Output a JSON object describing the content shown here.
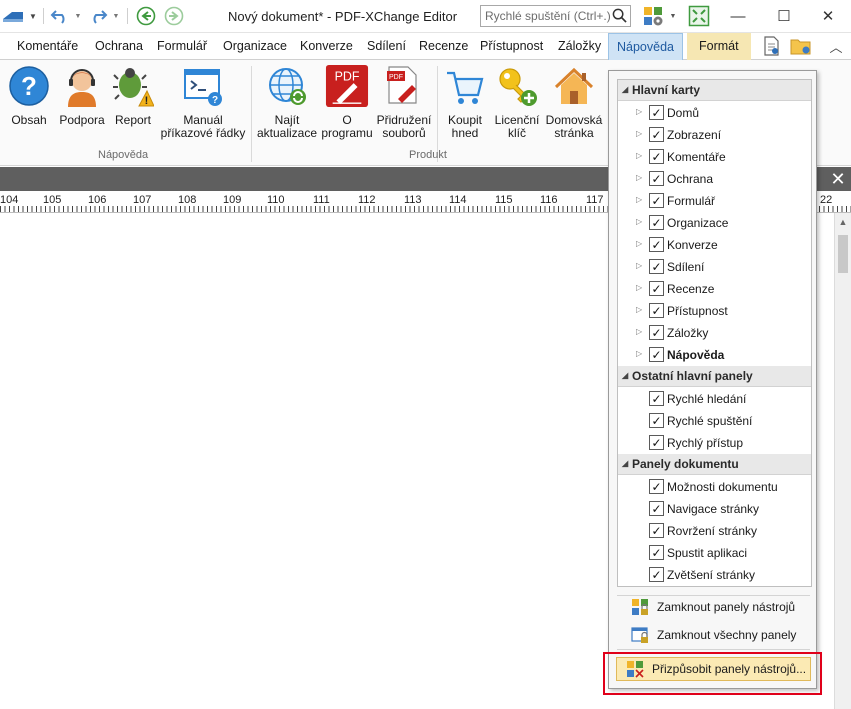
{
  "window": {
    "title": "Nový dokument* - PDF-XChange Editor",
    "quick_launch_placeholder": "Rychlé spuštění (Ctrl+.)",
    "close_glyph": "✕",
    "maximize_glyph": "☐",
    "minimize_glyph": "—",
    "qat_icons": [
      "dropdown-menu-icon",
      "undo-icon",
      "redo-icon",
      "back-icon",
      "forward-icon"
    ]
  },
  "tabs": [
    {
      "label": "Komentáře"
    },
    {
      "label": "Ochrana"
    },
    {
      "label": "Formulář"
    },
    {
      "label": "Organizace"
    },
    {
      "label": "Konverze"
    },
    {
      "label": "Sdílení"
    },
    {
      "label": "Recenze"
    },
    {
      "label": "Přístupnost"
    },
    {
      "label": "Záložky"
    },
    {
      "label": "Nápověda"
    },
    {
      "label": "Formát"
    }
  ],
  "ribbon": {
    "groups": [
      {
        "label": "Nápověda"
      },
      {
        "label": "Produkt"
      }
    ],
    "buttons": [
      {
        "line1": "Obsah",
        "line2": "",
        "icon": "help-icon"
      },
      {
        "line1": "Podpora",
        "line2": "",
        "icon": "support-icon"
      },
      {
        "line1": "Report",
        "line2": "",
        "icon": "bug-report-icon"
      },
      {
        "line1": "Manuál",
        "line2": "příkazové řádky",
        "icon": "command-line-icon"
      },
      {
        "line1": "Najít",
        "line2": "aktualizace",
        "icon": "update-icon"
      },
      {
        "line1": "O",
        "line2": "programu",
        "icon": "pdf-about-icon"
      },
      {
        "line1": "Přidružení",
        "line2": "souborů",
        "icon": "file-association-icon"
      },
      {
        "line1": "Koupit",
        "line2": "hned",
        "icon": "cart-icon"
      },
      {
        "line1": "Licenční",
        "line2": "klíč",
        "icon": "license-key-icon"
      },
      {
        "line1": "Domovská",
        "line2": "stránka",
        "icon": "home-icon"
      }
    ]
  },
  "ruler": {
    "labels": [
      "104",
      "105",
      "106",
      "107",
      "108",
      "109",
      "110",
      "111",
      "112",
      "113",
      "114",
      "115",
      "116",
      "117",
      "22"
    ]
  },
  "doc_tabs_close": "✕",
  "dropdown": {
    "sections": [
      {
        "title": "Hlavní karty",
        "items": [
          {
            "label": "Domů",
            "checked": true,
            "expandable": true
          },
          {
            "label": "Zobrazení",
            "checked": true,
            "expandable": true
          },
          {
            "label": "Komentáře",
            "checked": true,
            "expandable": true
          },
          {
            "label": "Ochrana",
            "checked": true,
            "expandable": true
          },
          {
            "label": "Formulář",
            "checked": true,
            "expandable": true
          },
          {
            "label": "Organizace",
            "checked": true,
            "expandable": true
          },
          {
            "label": "Konverze",
            "checked": true,
            "expandable": true
          },
          {
            "label": "Sdílení",
            "checked": true,
            "expandable": true
          },
          {
            "label": "Recenze",
            "checked": true,
            "expandable": true
          },
          {
            "label": "Přístupnost",
            "checked": true,
            "expandable": true
          },
          {
            "label": "Záložky",
            "checked": true,
            "expandable": true
          },
          {
            "label": "Nápověda",
            "checked": true,
            "expandable": true,
            "bold": true
          }
        ]
      },
      {
        "title": "Ostatní hlavní panely",
        "items": [
          {
            "label": "Rychlé hledání",
            "checked": true
          },
          {
            "label": "Rychlé spuštění",
            "checked": true
          },
          {
            "label": "Rychlý přístup",
            "checked": true
          }
        ]
      },
      {
        "title": "Panely dokumentu",
        "items": [
          {
            "label": "Možnosti dokumentu",
            "checked": true
          },
          {
            "label": "Navigace stránky",
            "checked": true
          },
          {
            "label": "Rovržení stránky",
            "checked": true
          },
          {
            "label": "Spustit aplikaci",
            "checked": true
          },
          {
            "label": "Zvětšení stránky",
            "checked": true
          }
        ]
      }
    ],
    "commands": [
      {
        "label": "Zamknout panely nástrojů",
        "icon": "lock-toolbars-icon"
      },
      {
        "label": "Zamknout všechny panely",
        "icon": "lock-panels-icon"
      },
      {
        "label": "Přizpůsobit panely nástrojů...",
        "icon": "customize-toolbars-icon",
        "highlighted": true
      }
    ]
  },
  "colors": {
    "accent": "#1f5aa0",
    "active_tab_bg": "#cfe3f5",
    "format_tab_bg": "#f6e7b3",
    "highlight_frame": "#e0001a",
    "doc_bar": "#5f5f5f"
  }
}
